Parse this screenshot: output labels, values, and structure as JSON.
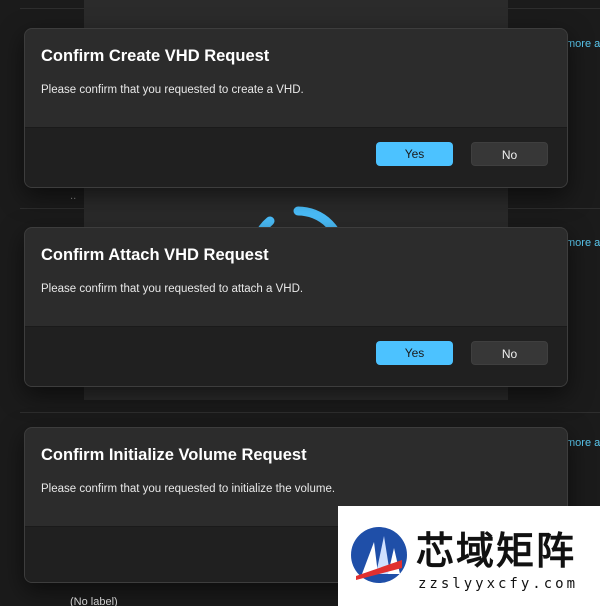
{
  "background": {
    "more_links": [
      "more a",
      "more a",
      "more a"
    ],
    "dots": "..",
    "partial_label": "(No label)"
  },
  "dialogs": [
    {
      "title": "Confirm Create VHD Request",
      "message": "Please confirm that you requested to create a VHD.",
      "yes_label": "Yes",
      "no_label": "No"
    },
    {
      "title": "Confirm Attach VHD Request",
      "message": "Please confirm that you requested to attach a VHD.",
      "yes_label": "Yes",
      "no_label": "No"
    },
    {
      "title": "Confirm Initialize Volume Request",
      "message": "Please confirm that you requested to initialize the volume."
    }
  ],
  "watermark": {
    "name": "芯域矩阵",
    "url": "zzslyyxcfy.com"
  },
  "colors": {
    "accent": "#4cc2ff",
    "link": "#5ac8ef",
    "dialog_bg": "#2c2c2c",
    "footer_bg": "#202020"
  },
  "icons": {
    "spinner": "loading-spinner-icon",
    "watermark_logo": "building-logo-icon"
  }
}
